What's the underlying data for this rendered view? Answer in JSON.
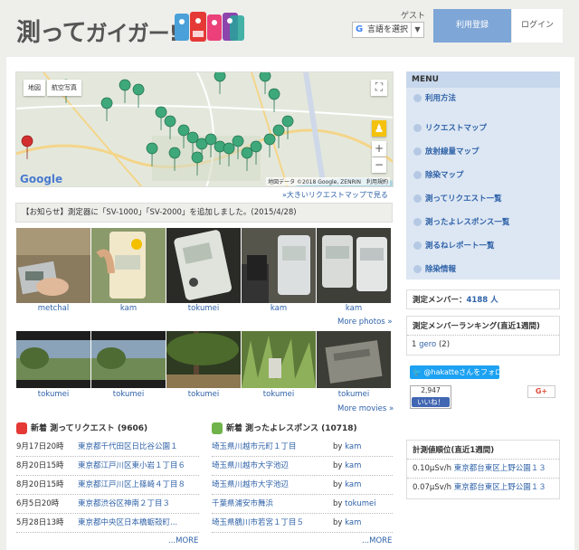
{
  "header": {
    "logo_text": "測って",
    "logo_kana": "ガイガー!",
    "guest_label": "ゲスト",
    "translate_label": "言語を選択",
    "translate_arrow": "▼",
    "register_label": "利用登録",
    "login_label": "ログイン"
  },
  "map": {
    "type_map": "地図",
    "type_satellite": "航空写真",
    "credit": "地図データ ©2018 Google, ZENRIN　利用規約",
    "google": "Google",
    "zoom_in": "+",
    "zoom_out": "−",
    "big_map_link": "»大きいリクエストマップで見る"
  },
  "notice": "【お知らせ】測定器に「SV-1000」「SV-2000」を追加しました。(2015/4/28)",
  "photos": [
    {
      "user": "metchal"
    },
    {
      "user": "kam"
    },
    {
      "user": "tokumei"
    },
    {
      "user": "kam"
    },
    {
      "user": "kam"
    }
  ],
  "more_photos": "More photos »",
  "movies": [
    {
      "user": "tokumei"
    },
    {
      "user": "tokumei"
    },
    {
      "user": "tokumei"
    },
    {
      "user": "tokumei"
    },
    {
      "user": "tokumei"
    }
  ],
  "more_movies": "More movies »",
  "requests": {
    "title": "新着 測ってリクエスト (9606)",
    "items": [
      {
        "date": "9月17日20時",
        "place": "東京都千代田区日比谷公園１"
      },
      {
        "date": "8月20日15時",
        "place": "東京都江戸川区東小岩１丁目６"
      },
      {
        "date": "8月20日15時",
        "place": "東京都江戸川区上篠崎４丁目８"
      },
      {
        "date": "6月5日20時",
        "place": "東京都渋谷区神南２丁目３"
      },
      {
        "date": "5月28日13時",
        "place": "東京都中央区日本橋蛎殻町..."
      }
    ],
    "more": "...MORE"
  },
  "responses": {
    "title": "新着 測ったよレスポンス (10718)",
    "items": [
      {
        "place": "埼玉県川越市元町１丁目",
        "by": "by",
        "user": "kam"
      },
      {
        "place": "埼玉県川越市大字池辺",
        "by": "by",
        "user": "kam"
      },
      {
        "place": "埼玉県川越市大字池辺",
        "by": "by",
        "user": "kam"
      },
      {
        "place": "千葉県浦安市舞浜",
        "by": "by",
        "user": "tokumei"
      },
      {
        "place": "埼玉県鶴川市若宮１丁目５",
        "by": "by",
        "user": "kam"
      }
    ],
    "more": "...MORE"
  },
  "menu": {
    "title": "MENU",
    "items": [
      "利用方法",
      "リクエストマップ",
      "放射線量マップ",
      "除染マップ",
      "測ってリクエスト一覧",
      "測ったよレスポンス一覧",
      "測るねレポート一覧",
      "除染情報"
    ]
  },
  "members": {
    "label": "測定メンバー：",
    "count": "4188 人"
  },
  "ranking": {
    "title": "測定メンバーランキング(直近1週間)",
    "items": [
      {
        "rank": "1",
        "user": "gero",
        "count": "(2)"
      }
    ]
  },
  "social": {
    "twitter": "@hakatteさんをフォロー",
    "fb_count": "2,947",
    "fb_like": "いいね！",
    "gplus": "G+"
  },
  "measure_rank": {
    "title": "計測値順位(直近1週間)",
    "items": [
      {
        "value": "0.10μSv/h",
        "place": "東京都台東区上野公園１３"
      },
      {
        "value": "0.07μSv/h",
        "place": "東京都台東区上野公園１３"
      }
    ]
  },
  "colors": {
    "accent": "#7ea6d6",
    "link": "#2f62a8",
    "menu_bg": "#dde7f3",
    "pin": "#3ea87a"
  }
}
